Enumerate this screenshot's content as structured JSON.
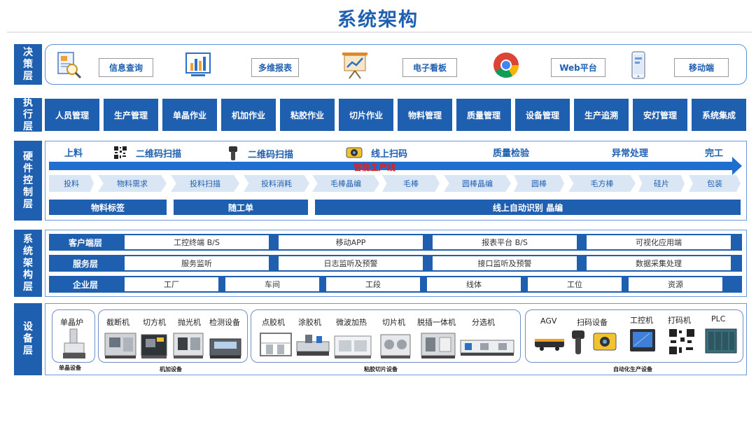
{
  "title": "系统架构",
  "layers": {
    "decision": {
      "label": [
        "决",
        "策",
        "层"
      ]
    },
    "execution": {
      "label": [
        "执",
        "行",
        "层"
      ]
    },
    "hardware": {
      "label": [
        "硬",
        "件",
        "控",
        "制",
        "层"
      ]
    },
    "architecture": {
      "label": [
        "系",
        "统",
        "架",
        "构",
        "层"
      ]
    },
    "equipment": {
      "label": [
        "设",
        "备",
        "层"
      ]
    }
  },
  "decision_items": [
    {
      "label": "信息查询",
      "icon": "document-search-icon"
    },
    {
      "label": "多维报表",
      "icon": "bar-chart-icon"
    },
    {
      "label": "电子看板",
      "icon": "presentation-board-icon"
    },
    {
      "label": "Web平台",
      "icon": "chrome-browser-icon"
    },
    {
      "label": "移动端",
      "icon": "mobile-phone-icon"
    }
  ],
  "execution_items": [
    "人员管理",
    "生产管理",
    "单晶作业",
    "机加作业",
    "粘胶作业",
    "切片作业",
    "物料管理",
    "质量管理",
    "设备管理",
    "生产追溯",
    "安灯管理",
    "系统集成"
  ],
  "hardware": {
    "stages": [
      {
        "label": "上料"
      },
      {
        "label": "二维码扫描",
        "icon": "qr-code-icon"
      },
      {
        "label": "二维码扫描",
        "icon": "handheld-scanner-icon"
      },
      {
        "label": "线上扫码",
        "icon": "barcode-reader-icon"
      },
      {
        "label": "质量检验"
      },
      {
        "label": "异常处理"
      },
      {
        "label": "完工"
      }
    ],
    "production_line": "智能生产线",
    "steps": [
      "投料",
      "物料需求",
      "投料扫描",
      "投料消耗",
      "毛棒晶编",
      "毛棒",
      "圆棒晶编",
      "圆棒",
      "毛方棒",
      "硅片",
      "包装"
    ],
    "bars": [
      "物料标签",
      "随工单",
      "线上自动识别 晶编"
    ]
  },
  "architecture": {
    "rows": [
      {
        "label": "客户端层",
        "cells": [
          "工控终端 B/S",
          "移动APP",
          "报表平台 B/S",
          "可视化应用端"
        ]
      },
      {
        "label": "服务层",
        "cells": [
          "服务监听",
          "日志监听及预警",
          "接口监听及预警",
          "数据采集处理"
        ]
      },
      {
        "label": "企业层",
        "cells": [
          "工厂",
          "车间",
          "工段",
          "线体",
          "工位",
          "资源"
        ]
      }
    ]
  },
  "equipment": {
    "groups": [
      {
        "name": "单晶设备",
        "items": [
          "单晶炉"
        ]
      },
      {
        "name": "机加设备",
        "items": [
          "截断机",
          "切方机",
          "抛光机",
          "检测设备"
        ]
      },
      {
        "name": "粘胶切片设备",
        "items": [
          "点胶机",
          "涂胶机",
          "微波加热",
          "切片机",
          "脱插一体机",
          "分选机"
        ]
      },
      {
        "name": "自动化生产设备",
        "items": [
          "AGV",
          "扫码设备",
          "工控机",
          "打码机",
          "PLC"
        ]
      }
    ]
  },
  "colors": {
    "primary": "#1f5fb0",
    "arrow": "#1f6fd0",
    "accent_red": "#e02020",
    "chevron": "#dbe6f5"
  }
}
